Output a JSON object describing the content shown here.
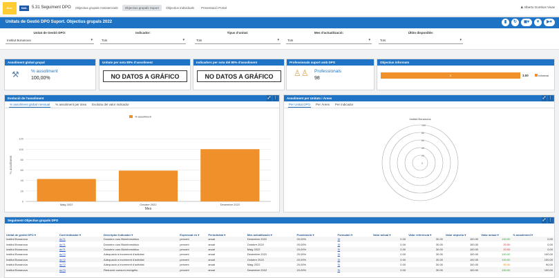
{
  "topnav": {
    "logo_text": "Ens.",
    "logo2_text": "MAIL",
    "title": "5.31 Seguiment DPO",
    "tabs": [
      {
        "label": "Objectius grupals Assistencials",
        "active": false
      },
      {
        "label": "Objectius grupals Suport",
        "active": true
      },
      {
        "label": "Objectius individuals",
        "active": false
      },
      {
        "label": "Presentació Portal",
        "active": false
      }
    ],
    "user": "Alberto Gombos Vivas"
  },
  "header": {
    "title": "Unitats de Gestió DPO Suport. Objectius grupals 2022",
    "icons": [
      "bookmark-icon",
      "refresh-icon",
      "toggle-icon",
      "filter-icon",
      "export-icon"
    ]
  },
  "filters": [
    {
      "label": "Unitat de Gestió DPO:",
      "value": "Institut Bonanova"
    },
    {
      "label": "Indicador:",
      "value": "Tots"
    },
    {
      "label": "Tipus d'unitat:",
      "value": "Tots"
    },
    {
      "label": "Mes d'actualització:",
      "value": "Tots"
    },
    {
      "label": "Últim disponible:",
      "value": "Tots"
    }
  ],
  "kpis": {
    "global": {
      "title": "Assoliment global grupal",
      "label": "% assoliment",
      "value": "100,00%"
    },
    "unitats": {
      "title": "Unitats per sota 80% d'assoliment",
      "nodata": "NO DATOS A GRÁFICO"
    },
    "indicadors": {
      "title": "Indicadors per sota del 80% d'assoliment",
      "nodata": "NO DATOS A GRÁFICO"
    },
    "professionals": {
      "title": "Professionals suport amb DPO",
      "label": "Professionals",
      "value": "98"
    },
    "informats": {
      "title": "Objectius informats",
      "bar_label": "1",
      "bar_value": "3.00",
      "legend": "Informat",
      "color": "#f0902a"
    }
  },
  "evolucio": {
    "title": "Evolució de l'assoliment",
    "tabs": [
      "% assoliment global mensual",
      "% assoliment per àrea",
      "Evolutiu del valor indicador"
    ],
    "active_tab": 0
  },
  "chart_data": {
    "type": "bar",
    "categories": [
      "Maig 2022",
      "Octubre 2022",
      "Desembre 2022"
    ],
    "series": [
      {
        "name": "% assoliment",
        "values": [
          43,
          59,
          100
        ],
        "color": "#f0902a"
      }
    ],
    "xlabel": "Mes",
    "ylabel": "% assoliment",
    "ylim": [
      0,
      140
    ],
    "yticks": [
      0,
      20,
      40,
      60,
      80,
      100,
      120
    ],
    "grid": true,
    "legend": "top"
  },
  "unitats": {
    "title": "Assoliment per Unitats i Àrees",
    "tabs": [
      "Per Unitat DPO",
      "Per Àrees",
      "Per indicador"
    ],
    "active_tab": 0,
    "radar_title": "Institut Bonanova",
    "radar_ticks": [
      "100",
      "80",
      "60",
      "40",
      "20",
      "0"
    ]
  },
  "table": {
    "title": "Seguiment Objectius grupals DPO",
    "headers": [
      "Unitat de gestió DPO",
      "Codi Indicador",
      "Descriptor Indicador",
      "Expressat en",
      "Periodicitat",
      "Mes actualització",
      "Ponderació",
      "Formulari",
      "Valor actual",
      "Valor referència",
      "Valor objectiu",
      "Valor actual",
      "% assoliment"
    ],
    "rows": [
      [
        "Institut Bonanova",
        "do71",
        "Dossiers curs Bioinformàtica",
        "percent",
        "anual",
        "Desembre 2022",
        "20,00%",
        "Si",
        "0.00",
        "30.00",
        "100.00",
        "100.00",
        "0,00",
        "green"
      ],
      [
        "Institut Bonanova",
        "do71",
        "Dossiers curs Bioinformàtica",
        "percent",
        "anual",
        "Octubre 2022",
        "20,00%",
        "Si",
        "0.00",
        "30.00",
        "100.00",
        "20.00",
        "0,00",
        "red"
      ],
      [
        "Institut Bonanova",
        "do71",
        "Dossiers curs Bioinformàtica",
        "percent",
        "anual",
        "Maig 2022",
        "20,00%",
        "Si",
        "0.00",
        "30.00",
        "100.00",
        "20.00",
        "0,00",
        "red"
      ],
      [
        "Institut Bonanova",
        "do72",
        "Adequació a increment d'activitat",
        "percent",
        "anual",
        "Desembre 2022",
        "20,00%",
        "Si",
        "0.00",
        "30.00",
        "100.00",
        "100.00",
        "100,00",
        "green"
      ],
      [
        "Institut Bonanova",
        "do72",
        "Adequació a increment d'activitat",
        "percent",
        "anual",
        "Octubre 2022",
        "20,00%",
        "Si",
        "0.00",
        "30.00",
        "100.00",
        "100.00",
        "100,00",
        "green"
      ],
      [
        "Institut Bonanova",
        "do72",
        "Adequació a increment d'activitat",
        "percent",
        "anual",
        "Maig 2022",
        "20,00%",
        "Si",
        "0.00",
        "30.00",
        "100.00",
        "90.00",
        "90,00",
        "orange"
      ],
      [
        "Institut Bonanova",
        "do73",
        "Reducció consum energètic",
        "percent",
        "anual",
        "Desembre 2022",
        "20,00%",
        "Si",
        "0.00",
        "30.00",
        "100.00",
        "100.00",
        "100,00",
        "green"
      ]
    ]
  }
}
